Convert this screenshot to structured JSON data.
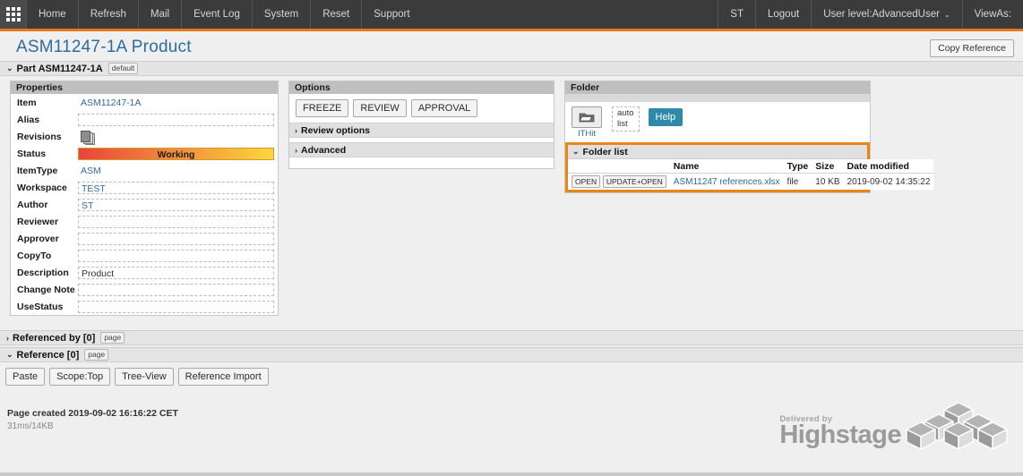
{
  "topnav": {
    "grid_icon": "apps-grid-icon",
    "left_items": [
      {
        "label": "Home"
      },
      {
        "label": "Refresh"
      },
      {
        "label": "Mail"
      },
      {
        "label": "Event Log"
      },
      {
        "label": "System"
      },
      {
        "label": "Reset"
      },
      {
        "label": "Support"
      }
    ],
    "right_items": [
      {
        "label": "ST"
      },
      {
        "label": "Logout"
      },
      {
        "label": "User level:AdvancedUser",
        "caret": "⌄"
      },
      {
        "label": "ViewAs:"
      }
    ],
    "accent_color": "#e8761a",
    "bg_color": "#3b3b3b"
  },
  "header": {
    "title": "ASM11247-1A Product",
    "title_color": "#2d6ca2",
    "copy_reference_label": "Copy Reference"
  },
  "part_section": {
    "chevron": "⌄",
    "label": "Part ASM11247-1A",
    "badge": "default"
  },
  "properties": {
    "panel_title": "Properties",
    "rows": [
      {
        "label": "Item",
        "value": "ASM11247-1A",
        "kind": "link"
      },
      {
        "label": "Alias",
        "value": "",
        "kind": "input"
      },
      {
        "label": "Revisions",
        "value": "",
        "kind": "revisions-icon"
      },
      {
        "label": "Status",
        "value": "Working",
        "kind": "statusbar"
      },
      {
        "label": "ItemType",
        "value": "ASM",
        "kind": "link"
      },
      {
        "label": "Workspace",
        "value": "TEST",
        "kind": "input"
      },
      {
        "label": "Author",
        "value": "ST",
        "kind": "input"
      },
      {
        "label": "Reviewer",
        "value": "",
        "kind": "input"
      },
      {
        "label": "Approver",
        "value": "",
        "kind": "input"
      },
      {
        "label": "CopyTo",
        "value": "",
        "kind": "input"
      },
      {
        "label": "Description",
        "value": "Product",
        "kind": "input-dark"
      },
      {
        "label": "Change Note",
        "value": "",
        "kind": "input"
      },
      {
        "label": "UseStatus",
        "value": "",
        "kind": "input"
      }
    ],
    "status_gradient_from": "#e8453c",
    "status_gradient_to": "#fcd63b"
  },
  "options": {
    "panel_title": "Options",
    "buttons": [
      {
        "label": "FREEZE"
      },
      {
        "label": "REVIEW"
      },
      {
        "label": "APPROVAL"
      }
    ],
    "sections": [
      {
        "chevron": "›",
        "label": "Review options"
      },
      {
        "chevron": "›",
        "label": "Advanced"
      }
    ]
  },
  "folder": {
    "panel_title": "Folder",
    "ithit": {
      "icon": "folder-open-icon",
      "label": "ITHit"
    },
    "auto_label": "auto",
    "list_label": "list",
    "help_label": "Help",
    "help_color": "#2f89a8",
    "highlight_color": "#e8861a",
    "folder_list": {
      "chevron": "⌄",
      "title": "Folder list",
      "columns": [
        "",
        "Name",
        "Type",
        "Size",
        "Date modified"
      ],
      "rows": [
        {
          "open_label": "OPEN",
          "update_open_label": "UPDATE+OPEN",
          "name": "ASM11247 references.xlsx",
          "type": "file",
          "size": "10 KB",
          "date_modified": "2019-09-02 14:35:22"
        }
      ]
    }
  },
  "referenced_by": {
    "chevron": "›",
    "label": "Referenced by [0]",
    "badge": "page"
  },
  "reference": {
    "chevron": "⌄",
    "label": "Reference [0]",
    "badge": "page",
    "buttons": [
      {
        "label": "Paste"
      },
      {
        "label": "Scope:Top"
      },
      {
        "label": "Tree-View"
      },
      {
        "label": "Reference Import"
      }
    ]
  },
  "footer": {
    "page_created": "Page created 2019-09-02 16:16:22 CET",
    "perf": "31ms/14KB",
    "logo_small": "Delivered by",
    "logo_large": "Highstage"
  }
}
